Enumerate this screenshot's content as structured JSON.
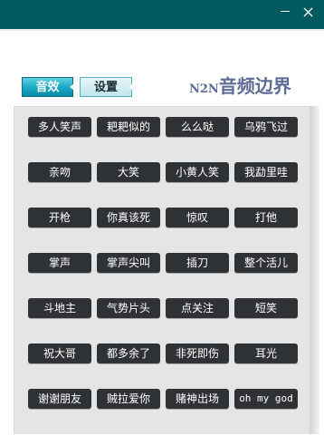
{
  "window": {
    "minimize_symbol": "—",
    "title_bar_color": "#005a60"
  },
  "tabs": {
    "effects_label": "音效",
    "settings_label": "设置",
    "active": "effects"
  },
  "brand": {
    "latin": "N2N",
    "cjk": "音频边界",
    "color": "#5d6b95"
  },
  "sound_buttons": [
    "多人笑声",
    "耙耙似的",
    "么么哒",
    "乌鸦飞过",
    "亲吻",
    "大笑",
    "小黄人笑",
    "我勐里哇",
    "开枪",
    "你真该死",
    "惊叹",
    "打他",
    "掌声",
    "掌声尖叫",
    "插刀",
    "整个活儿",
    "斗地主",
    "气势片头",
    "点关注",
    "短笑",
    "祝大哥",
    "都多余了",
    "非死即伤",
    "耳光",
    "谢谢朋友",
    "贼拉爱你",
    "赌神出场",
    "oh my god"
  ],
  "colors": {
    "button_bg": "#2f3234",
    "button_text": "#ffffff",
    "panel_bg": "#e5e5e5"
  }
}
